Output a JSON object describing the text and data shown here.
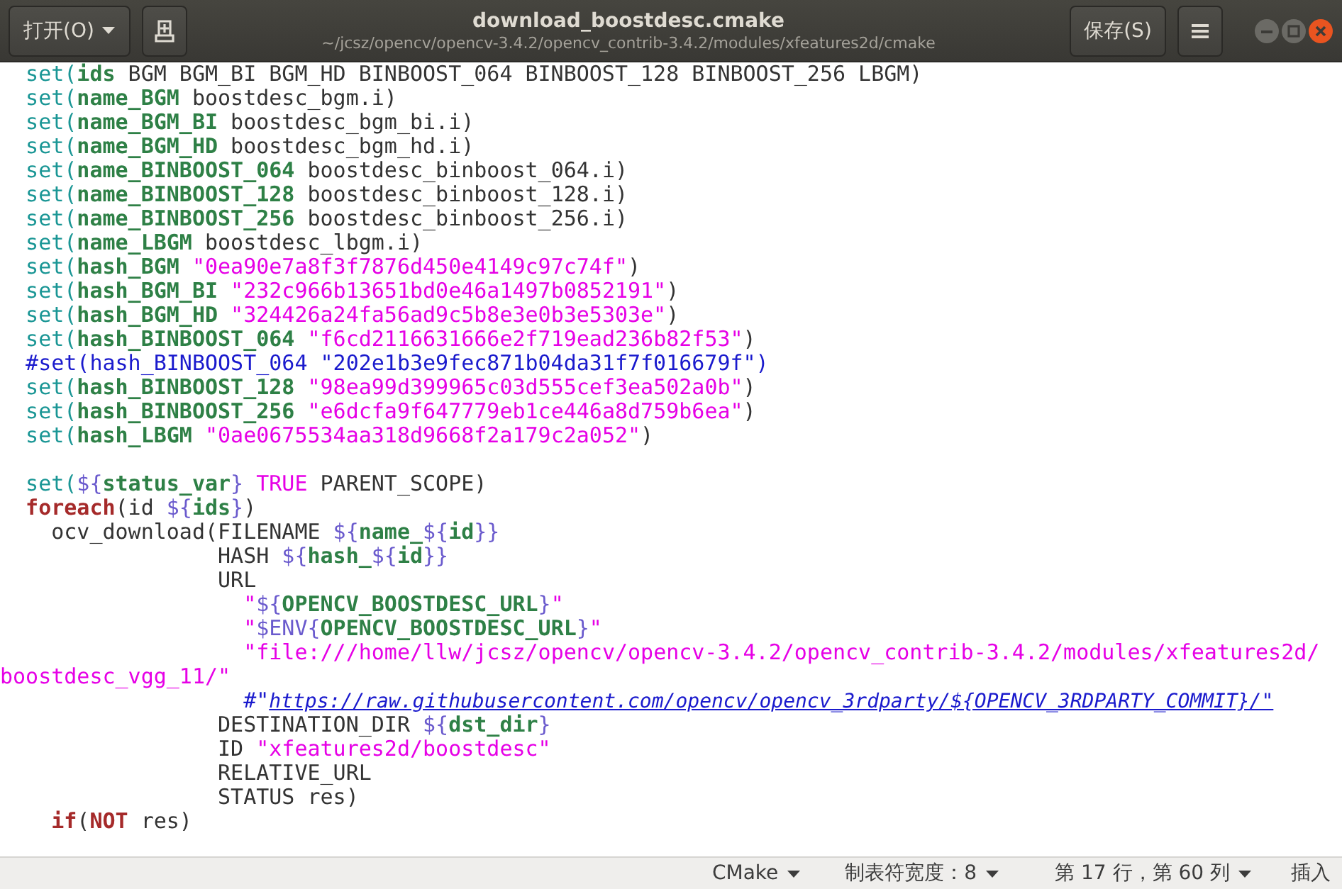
{
  "header": {
    "open_button": "打开(O)",
    "title": "download_boostdesc.cmake",
    "subtitle": "~/jcsz/opencv/opencv-3.4.2/opencv_contrib-3.4.2/modules/xfeatures2d/cmake",
    "save_button": "保存(S)"
  },
  "code": {
    "lines": [
      {
        "kind": "top",
        "tokens": [
          {
            "kind": "keyword",
            "text": "set("
          },
          {
            "kind": "variable",
            "text": "ids"
          },
          {
            "kind": "plain",
            "text": " BGM BGM_BI BGM_HD BINBOOST_064 BINBOOST_128 BINBOOST_256 LBGM)"
          }
        ]
      },
      {
        "kind": "top",
        "tokens": [
          {
            "kind": "keyword",
            "text": "set("
          },
          {
            "kind": "variable",
            "text": "name_BGM"
          },
          {
            "kind": "plain",
            "text": " boostdesc_bgm.i)"
          }
        ]
      },
      {
        "kind": "top",
        "tokens": [
          {
            "kind": "keyword",
            "text": "set("
          },
          {
            "kind": "variable",
            "text": "name_BGM_BI"
          },
          {
            "kind": "plain",
            "text": " boostdesc_bgm_bi.i)"
          }
        ]
      },
      {
        "kind": "top",
        "tokens": [
          {
            "kind": "keyword",
            "text": "set("
          },
          {
            "kind": "variable",
            "text": "name_BGM_HD"
          },
          {
            "kind": "plain",
            "text": " boostdesc_bgm_hd.i)"
          }
        ]
      },
      {
        "kind": "top",
        "tokens": [
          {
            "kind": "keyword",
            "text": "set("
          },
          {
            "kind": "variable",
            "text": "name_BINBOOST_064"
          },
          {
            "kind": "plain",
            "text": " boostdesc_binboost_064.i)"
          }
        ]
      },
      {
        "kind": "top",
        "tokens": [
          {
            "kind": "keyword",
            "text": "set("
          },
          {
            "kind": "variable",
            "text": "name_BINBOOST_128"
          },
          {
            "kind": "plain",
            "text": " boostdesc_binboost_128.i)"
          }
        ]
      },
      {
        "kind": "top",
        "tokens": [
          {
            "kind": "keyword",
            "text": "set("
          },
          {
            "kind": "variable",
            "text": "name_BINBOOST_256"
          },
          {
            "kind": "plain",
            "text": " boostdesc_binboost_256.i)"
          }
        ]
      },
      {
        "kind": "top",
        "tokens": [
          {
            "kind": "keyword",
            "text": "set("
          },
          {
            "kind": "variable",
            "text": "name_LBGM"
          },
          {
            "kind": "plain",
            "text": " boostdesc_lbgm.i)"
          }
        ]
      },
      {
        "kind": "top",
        "tokens": [
          {
            "kind": "keyword",
            "text": "set("
          },
          {
            "kind": "variable",
            "text": "hash_BGM"
          },
          {
            "kind": "string",
            "text": " \"0ea90e7a8f3f7876d450e4149c97c74f\""
          },
          {
            "kind": "plain",
            "text": ")"
          }
        ]
      },
      {
        "kind": "top",
        "tokens": [
          {
            "kind": "keyword",
            "text": "set("
          },
          {
            "kind": "variable",
            "text": "hash_BGM_BI"
          },
          {
            "kind": "string",
            "text": " \"232c966b13651bd0e46a1497b0852191\""
          },
          {
            "kind": "plain",
            "text": ")"
          }
        ]
      },
      {
        "kind": "top",
        "tokens": [
          {
            "kind": "keyword",
            "text": "set("
          },
          {
            "kind": "variable",
            "text": "hash_BGM_HD"
          },
          {
            "kind": "string",
            "text": " \"324426a24fa56ad9c5b8e3e0b3e5303e\""
          },
          {
            "kind": "plain",
            "text": ")"
          }
        ]
      },
      {
        "kind": "top",
        "tokens": [
          {
            "kind": "keyword",
            "text": "set("
          },
          {
            "kind": "variable",
            "text": "hash_BINBOOST_064"
          },
          {
            "kind": "string",
            "text": " \"f6cd2116631666e2f719ead236b82f53\""
          },
          {
            "kind": "plain",
            "text": ")"
          }
        ]
      },
      {
        "kind": "top",
        "tokens": [
          {
            "kind": "comment",
            "text": "#set(hash_BINBOOST_064 \"202e1b3e9fec871b04da31f7f016679f\")"
          }
        ]
      },
      {
        "kind": "top",
        "tokens": [
          {
            "kind": "keyword",
            "text": "set("
          },
          {
            "kind": "variable",
            "text": "hash_BINBOOST_128"
          },
          {
            "kind": "string",
            "text": " \"98ea99d399965c03d555cef3ea502a0b\""
          },
          {
            "kind": "plain",
            "text": ")"
          }
        ]
      },
      {
        "kind": "top",
        "tokens": [
          {
            "kind": "keyword",
            "text": "set("
          },
          {
            "kind": "variable",
            "text": "hash_BINBOOST_256"
          },
          {
            "kind": "string",
            "text": " \"e6dcfa9f647779eb1ce446a8d759b6ea\""
          },
          {
            "kind": "plain",
            "text": ")"
          }
        ]
      },
      {
        "kind": "top",
        "tokens": [
          {
            "kind": "keyword",
            "text": "set("
          },
          {
            "kind": "variable",
            "text": "hash_LBGM"
          },
          {
            "kind": "string",
            "text": " \"0ae0675534aa318d9668f2a179c2a052\""
          },
          {
            "kind": "plain",
            "text": ")"
          }
        ]
      },
      {
        "kind": "blank"
      },
      {
        "kind": "top",
        "tokens": [
          {
            "kind": "keyword",
            "text": "set("
          },
          {
            "kind": "brace",
            "text": "${"
          },
          {
            "kind": "variable",
            "text": "status_var"
          },
          {
            "kind": "brace",
            "text": "}"
          },
          {
            "kind": "string",
            "text": " TRUE"
          },
          {
            "kind": "plain",
            "text": " PARENT_SCOPE)"
          }
        ]
      },
      {
        "kind": "top",
        "tokens": [
          {
            "kind": "control",
            "text": "foreach"
          },
          {
            "kind": "plain",
            "text": "(id "
          },
          {
            "kind": "brace",
            "text": "${"
          },
          {
            "kind": "variable",
            "text": "ids"
          },
          {
            "kind": "brace",
            "text": "}"
          },
          {
            "kind": "plain",
            "text": ")"
          }
        ]
      },
      {
        "kind": "block",
        "tokens": [
          {
            "kind": "plain",
            "text": "ocv_download(FILENAME "
          },
          {
            "kind": "brace",
            "text": "${"
          },
          {
            "kind": "variable",
            "text": "name_"
          },
          {
            "kind": "brace",
            "text": "${"
          },
          {
            "kind": "variable",
            "text": "id"
          },
          {
            "kind": "brace",
            "text": "}}"
          }
        ]
      },
      {
        "kind": "arg",
        "tokens": [
          {
            "kind": "plain",
            "text": "HASH "
          },
          {
            "kind": "brace",
            "text": "${"
          },
          {
            "kind": "variable",
            "text": "hash_"
          },
          {
            "kind": "brace",
            "text": "${"
          },
          {
            "kind": "variable",
            "text": "id"
          },
          {
            "kind": "brace",
            "text": "}}"
          }
        ]
      },
      {
        "kind": "arg",
        "tokens": [
          {
            "kind": "plain",
            "text": "URL"
          }
        ]
      },
      {
        "kind": "url",
        "tokens": [
          {
            "kind": "string",
            "text": "\""
          },
          {
            "kind": "brace",
            "text": "${"
          },
          {
            "kind": "variable",
            "text": "OPENCV_BOOSTDESC_URL"
          },
          {
            "kind": "brace",
            "text": "}"
          },
          {
            "kind": "string",
            "text": "\""
          }
        ]
      },
      {
        "kind": "url",
        "tokens": [
          {
            "kind": "string",
            "text": "\""
          },
          {
            "kind": "brace",
            "text": "$ENV{"
          },
          {
            "kind": "variable",
            "text": "OPENCV_BOOSTDESC_URL"
          },
          {
            "kind": "brace",
            "text": "}"
          },
          {
            "kind": "string",
            "text": "\""
          }
        ]
      },
      {
        "kind": "url",
        "tokens": [
          {
            "kind": "string",
            "text": "\"file:///home/llw/jcsz/opencv/opencv-3.4.2/opencv_contrib-3.4.2/modules/xfeatures2d/"
          }
        ]
      },
      {
        "kind": "wrap",
        "tokens": [
          {
            "kind": "string",
            "text": "boostdesc_vgg_11/\""
          }
        ]
      },
      {
        "kind": "url",
        "tokens": [
          {
            "kind": "comment",
            "text": "#\""
          },
          {
            "kind": "link",
            "text": "https://raw.githubusercontent.com/opencv/opencv_3rdparty/${OPENCV_3RDPARTY_COMMIT}/\""
          }
        ]
      },
      {
        "kind": "arg",
        "tokens": [
          {
            "kind": "plain",
            "text": "DESTINATION_DIR "
          },
          {
            "kind": "brace",
            "text": "${"
          },
          {
            "kind": "variable",
            "text": "dst_dir"
          },
          {
            "kind": "brace",
            "text": "}"
          }
        ]
      },
      {
        "kind": "arg",
        "tokens": [
          {
            "kind": "plain",
            "text": "ID "
          },
          {
            "kind": "string",
            "text": "\"xfeatures2d/boostdesc\""
          }
        ]
      },
      {
        "kind": "arg",
        "tokens": [
          {
            "kind": "plain",
            "text": "RELATIVE_URL"
          }
        ]
      },
      {
        "kind": "arg",
        "tokens": [
          {
            "kind": "plain",
            "text": "STATUS res)"
          }
        ]
      },
      {
        "kind": "block",
        "tokens": [
          {
            "kind": "control",
            "text": "if"
          },
          {
            "kind": "plain",
            "text": "("
          },
          {
            "kind": "control",
            "text": "NOT"
          },
          {
            "kind": "plain",
            "text": " res)"
          }
        ]
      }
    ]
  },
  "status_bar": {
    "language": "CMake",
    "tab_width": "制表符宽度：8",
    "position": "第 17 行，第 60 列",
    "mode": "插入"
  }
}
